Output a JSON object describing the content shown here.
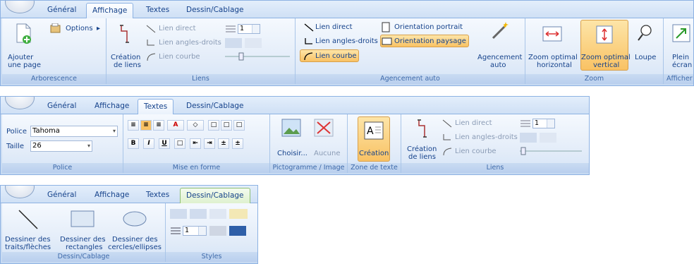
{
  "tabs": {
    "general": "Général",
    "affichage": "Affichage",
    "textes": "Textes",
    "dessin": "Dessin/Cablage"
  },
  "r1": {
    "ajouter1": "Ajouter",
    "ajouter2": "une page",
    "options": "Options",
    "arborescence": "Arborescence",
    "creation1": "Création",
    "creation2": "de liens",
    "lien_direct": "Lien direct",
    "lien_angles": "Lien angles-droits",
    "lien_courbe": "Lien courbe",
    "spin_val": "1",
    "liens": "Liens",
    "ag_lien_direct": "Lien direct",
    "ag_lien_angles": "Lien angles-droits",
    "ag_lien_courbe": "Lien courbe",
    "orientation_portrait": "Orientation portrait",
    "orientation_paysage": "Orientation paysage",
    "agencement1": "Agencement",
    "agencement2": "auto",
    "agencement_auto": "Agencement auto",
    "zoom_h1": "Zoom optimal",
    "zoom_h2": "horizontal",
    "zoom_v1": "Zoom optimal",
    "zoom_v2": "vertical",
    "loupe": "Loupe",
    "zoom": "Zoom",
    "plein1": "Plein",
    "plein2": "écran",
    "afficher": "Afficher"
  },
  "r2": {
    "police_lbl": "Police",
    "police_val": "Tahoma",
    "taille_lbl": "Taille",
    "taille_val": "26",
    "police_group": "Police",
    "mise_en_forme": "Mise en forme",
    "b": "B",
    "i": "I",
    "u": "U",
    "choisir": "Choisir...",
    "aucune": "Aucune",
    "picto_group": "Pictogramme / Image",
    "creation": "Création",
    "zone_texte": "Zone de texte",
    "creation1": "Création",
    "creation2": "de liens",
    "lien_direct": "Lien direct",
    "lien_angles": "Lien angles-droits",
    "lien_courbe": "Lien courbe",
    "spin_val": "1",
    "liens": "Liens"
  },
  "r3": {
    "traits1": "Dessiner des",
    "traits2": "traits/flèches",
    "rect1": "Dessiner des",
    "rect2": "rectangles",
    "cercles1": "Dessiner des",
    "cercles2": "cercles/ellipses",
    "dessin_group": "Dessin/Cablage",
    "spin_val": "1",
    "styles": "Styles"
  },
  "colors": {
    "accent": "#15428b",
    "active_btn": "#f9c264",
    "group_label": "#3e6aaa"
  }
}
